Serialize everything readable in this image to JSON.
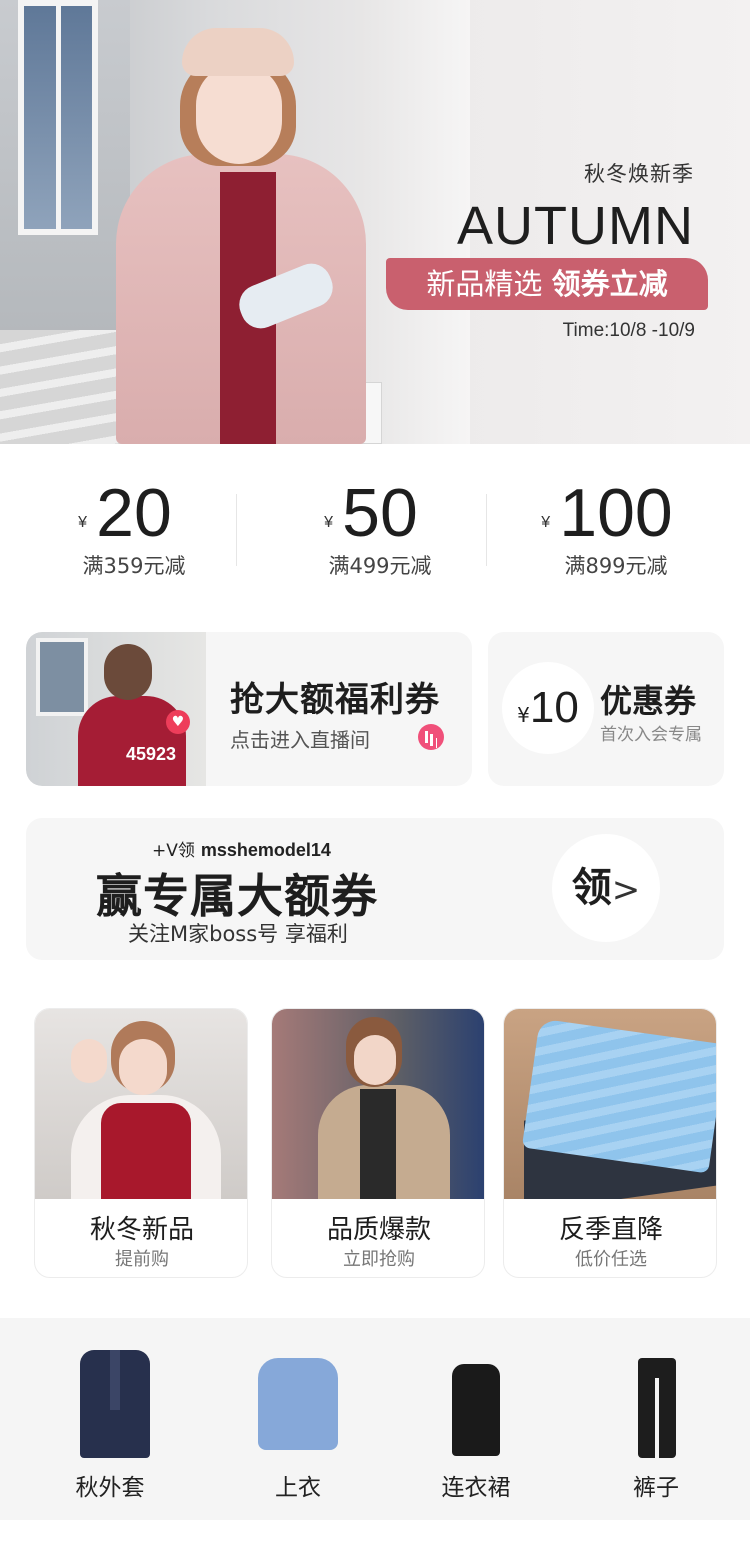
{
  "hero": {
    "subtitle": "秋冬焕新季",
    "title": "AUTUMN",
    "ribbon_left": "新品精选 ",
    "ribbon_right": "领券立减",
    "time": "Time:10/8 -10/9"
  },
  "coupons": [
    {
      "currency": "¥",
      "amount": "20",
      "condition": "满359元减"
    },
    {
      "currency": "¥",
      "amount": "50",
      "condition": "满499元减"
    },
    {
      "currency": "¥",
      "amount": "100",
      "condition": "满899元减"
    }
  ],
  "live": {
    "title": "抢大额福利券",
    "subtitle": "点击进入直播间",
    "viewer_count": "45923"
  },
  "vip": {
    "currency": "¥",
    "amount": "10",
    "title": "优惠券",
    "subtitle": "首次入会专属"
  },
  "follow": {
    "tag_prefix": "+V领",
    "tag_account": "msshemodel14",
    "title": "赢专属大额券",
    "subtitle": "关注M家boss号 享福利",
    "button_label": "领",
    "button_arrow": ">"
  },
  "tiles": [
    {
      "label": "秋冬新品",
      "sub": "提前购"
    },
    {
      "label": "品质爆款",
      "sub": "立即抢购"
    },
    {
      "label": "反季直降",
      "sub": "低价任选"
    }
  ],
  "categories": [
    {
      "label": "秋外套"
    },
    {
      "label": "上衣"
    },
    {
      "label": "连衣裙"
    },
    {
      "label": "裤子"
    }
  ],
  "colors": {
    "ribbon": "#c9606e",
    "card_bg": "#f6f6f6",
    "live_icon": "#f0507a",
    "heart": "#ee3d5a"
  }
}
